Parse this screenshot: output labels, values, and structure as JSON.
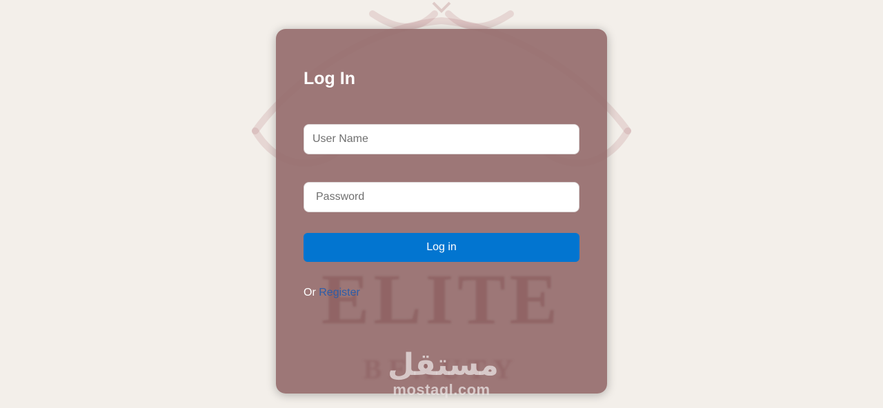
{
  "background": {
    "brand_text": "ELITE",
    "sub_text": "BEAUTY"
  },
  "login_card": {
    "title": "Log In",
    "username_placeholder": "User Name",
    "password_placeholder": "Password",
    "submit_label": "Log in",
    "register_prefix": "Or",
    "register_link": "Register"
  },
  "watermark": {
    "arabic": "مستقل",
    "latin": "mostaql.com"
  },
  "colors": {
    "page_background": "#f3efea",
    "card_background": "#966e6e",
    "button": "#0275d0",
    "link": "#2d5da8"
  }
}
